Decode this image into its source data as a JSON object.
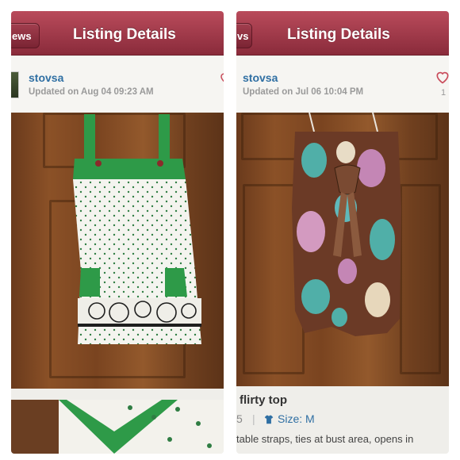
{
  "left": {
    "back_label": "ews",
    "title": "Listing Details",
    "username": "stovsa",
    "updated": "Updated on Aug 04 09:23 AM"
  },
  "right": {
    "back_label": "vs",
    "title": "Listing Details",
    "username": "stovsa",
    "updated": "Updated on Jul 06 10:04 PM",
    "like_count": "1",
    "product_title": "flirty top",
    "price_fragment": "5",
    "size_label": "Size: M",
    "description": "table straps, ties at bust area, opens in"
  },
  "colors": {
    "navbar": "#9c3446",
    "link": "#2f6fa3",
    "heart": "#c94a5a"
  },
  "icons": [
    "back-button",
    "heart-icon",
    "shirt-icon",
    "avatar"
  ]
}
